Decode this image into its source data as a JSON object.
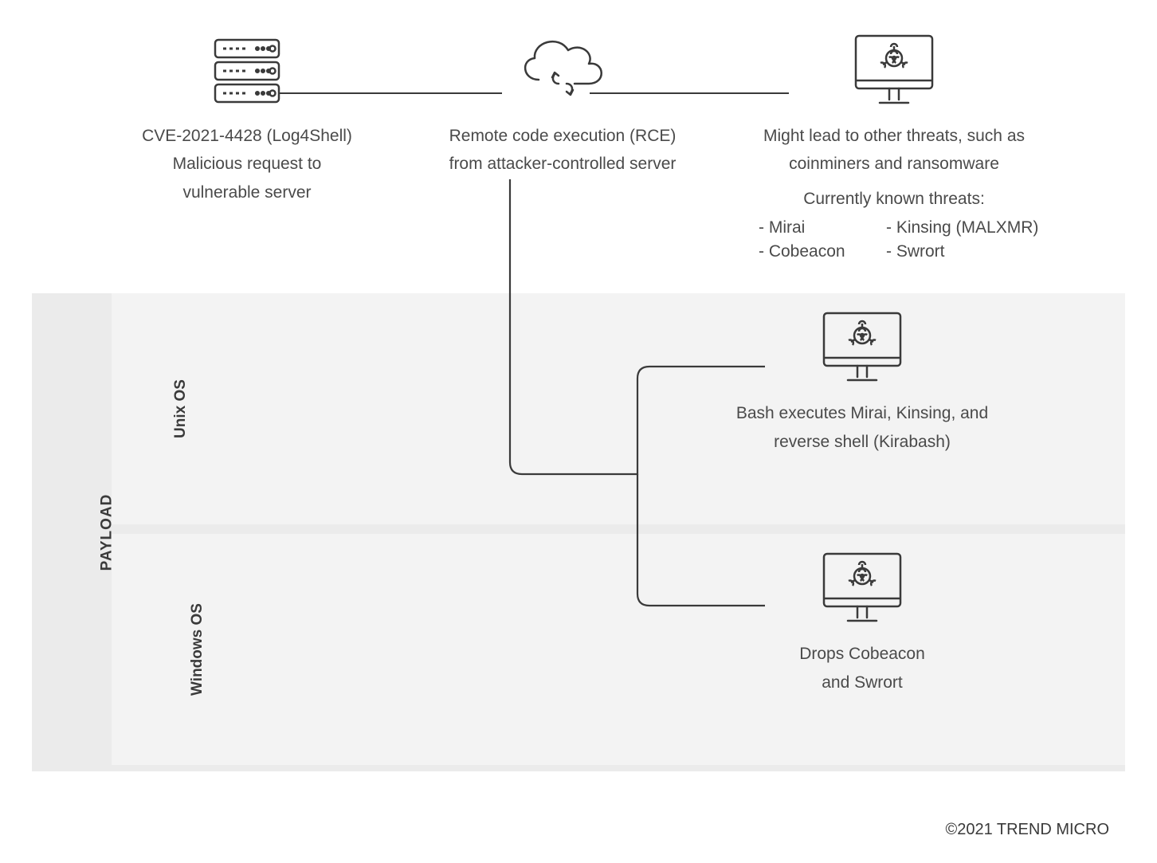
{
  "top": {
    "node1": {
      "line1": "CVE-2021-4428 (Log4Shell)",
      "line2": "Malicious request to",
      "line3": "vulnerable server"
    },
    "node2": {
      "line1": "Remote code execution (RCE)",
      "line2": "from attacker-controlled server"
    },
    "node3": {
      "line1": "Might lead to other threats, such as",
      "line2": "coinminers and ransomware",
      "sub": "Currently known threats:",
      "threats": {
        "a": "- Mirai",
        "b": "- Kinsing (MALXMR)",
        "c": "- Cobeacon",
        "d": "- Swrort"
      }
    }
  },
  "payload": {
    "label": "PAYLOAD",
    "unix": {
      "label": "Unix OS",
      "caption1": "Bash executes Mirai, Kinsing, and",
      "caption2": "reverse shell (Kirabash)"
    },
    "windows": {
      "label": "Windows OS",
      "caption1": "Drops Cobeacon",
      "caption2": "and Swrort"
    }
  },
  "copyright": "©2021 TREND MICRO"
}
